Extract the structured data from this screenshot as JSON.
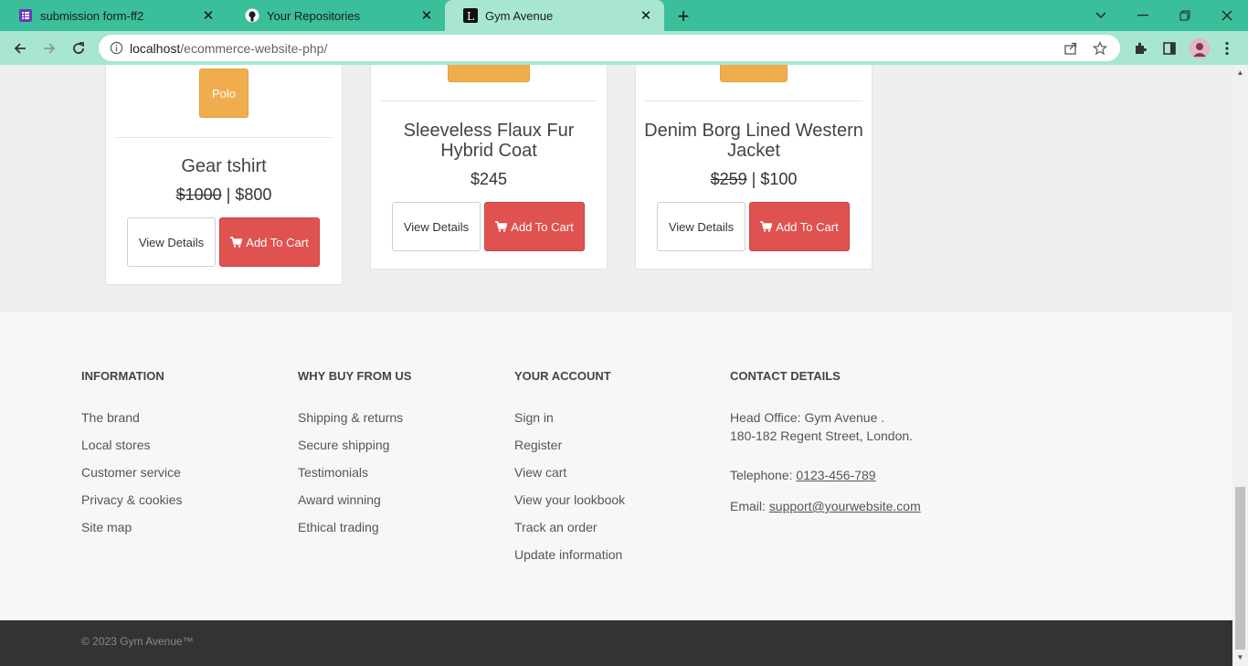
{
  "browser": {
    "tabs": [
      {
        "title": "submission form-ff2",
        "favicon": "forms-icon",
        "active": false
      },
      {
        "title": "Your Repositories",
        "favicon": "github-icon",
        "active": false
      },
      {
        "title": "Gym Avenue",
        "favicon": "letter-L-icon",
        "active": true
      }
    ],
    "url_host": "localhost",
    "url_path": "/ecommerce-website-php/"
  },
  "products": [
    {
      "tag": "Polo",
      "name": "Gear tshirt",
      "old_price": "$1000",
      "price": "$800",
      "view_label": "View Details",
      "cart_label": "Add To Cart"
    },
    {
      "tag": "",
      "name": "Sleeveless Flaux Fur Hybrid Coat",
      "old_price": "",
      "price": "$245",
      "view_label": "View Details",
      "cart_label": "Add To Cart"
    },
    {
      "tag": "",
      "name": "Denim Borg Lined Western Jacket",
      "old_price": "$259",
      "price": "$100",
      "view_label": "View Details",
      "cart_label": "Add To Cart"
    }
  ],
  "footer": {
    "information": {
      "heading": "INFORMATION",
      "links": [
        "The brand",
        "Local stores",
        "Customer service",
        "Privacy & cookies",
        "Site map"
      ]
    },
    "why_buy": {
      "heading": "WHY BUY FROM US",
      "links": [
        "Shipping & returns",
        "Secure shipping",
        "Testimonials",
        "Award winning",
        "Ethical trading"
      ]
    },
    "account": {
      "heading": "YOUR ACCOUNT",
      "links": [
        "Sign in",
        "Register",
        "View cart",
        "View your lookbook",
        "Track an order",
        "Update information"
      ]
    },
    "contact": {
      "heading": "CONTACT DETAILS",
      "address_line1": "Head Office: Gym Avenue .",
      "address_line2": "180-182 Regent Street, London.",
      "telephone_label": "Telephone: ",
      "telephone": "0123-456-789",
      "email_label": "Email: ",
      "email": "support@yourwebsite.com"
    },
    "copyright": "© 2023 Gym Avenue™"
  },
  "colors": {
    "tabbar": "#3bbf9a",
    "toolbar": "#a8e6d2",
    "cart_button": "#e0524f",
    "tag": "#f0ad4e",
    "footer_bottom": "#333333"
  }
}
